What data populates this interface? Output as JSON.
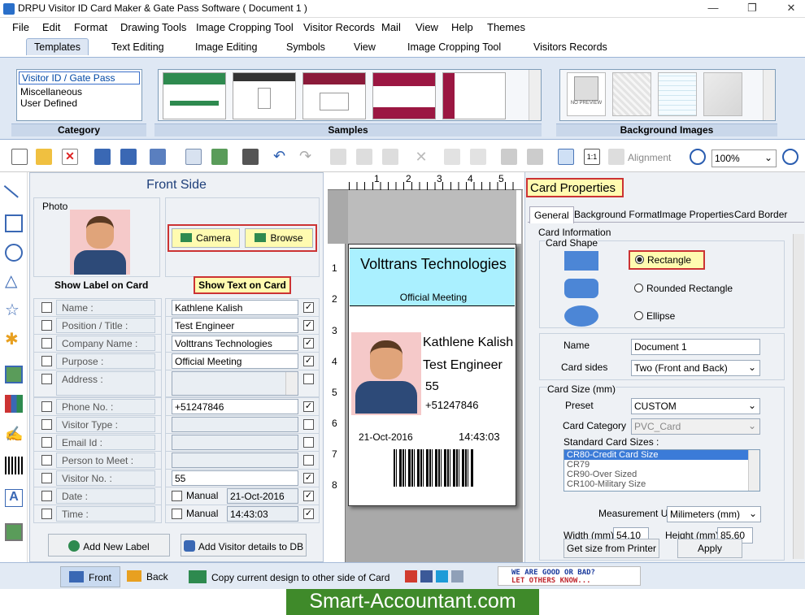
{
  "window": {
    "title": "DRPU Visitor ID Card Maker & Gate Pass Software ( Document 1 )",
    "min": "—",
    "max": "❐",
    "close": "✕"
  },
  "menu": [
    "File",
    "Edit",
    "Format",
    "Drawing Tools",
    "Image Cropping Tool",
    "Visitor Records",
    "Mail",
    "View",
    "Help",
    "Themes"
  ],
  "ribbon_tabs": [
    "Templates",
    "Text Editing",
    "Image Editing",
    "Symbols",
    "View",
    "Image Cropping Tool",
    "Visitors Records"
  ],
  "ribbon": {
    "category_items": [
      "Visitor ID / Gate Pass",
      "Miscellaneous",
      "User Defined"
    ],
    "category_label": "Category",
    "samples_label": "Samples",
    "bg_label": "Background Images",
    "no_preview": "NO PREVIEW"
  },
  "toolbar": {
    "alignment": "Alignment",
    "zoom": "100%"
  },
  "front": {
    "title": "Front Side",
    "photo_label": "Photo",
    "camera": "Camera",
    "browse": "Browse",
    "show_label": "Show Label on Card",
    "show_text": "Show Text on Card",
    "rows": [
      {
        "label": "Name :",
        "value": "Kathlene Kalish",
        "checked": true
      },
      {
        "label": "Position / Title :",
        "value": "Test Engineer",
        "checked": true
      },
      {
        "label": "Company Name :",
        "value": "Volttrans Technologies",
        "checked": true
      },
      {
        "label": "Purpose :",
        "value": "Official Meeting",
        "checked": true
      },
      {
        "label": "Address :",
        "value": "",
        "checked": false
      },
      {
        "label": "Phone No. :",
        "value": "+51247846",
        "checked": true
      },
      {
        "label": "Visitor Type :",
        "value": "",
        "checked": false
      },
      {
        "label": "Email Id :",
        "value": "",
        "checked": false
      },
      {
        "label": "Person to Meet :",
        "value": "",
        "checked": false
      },
      {
        "label": "Visitor No. :",
        "value": "55",
        "checked": true
      },
      {
        "label": "Date :",
        "value": "21-Oct-2016",
        "checked": true
      },
      {
        "label": "Time :",
        "value": "14:43:03",
        "checked": true
      }
    ],
    "manual": "Manual",
    "add_label": "Add New Label",
    "add_db": "Add Visitor details to DB"
  },
  "ruler": {
    "h": [
      "1",
      "2",
      "3",
      "4",
      "5"
    ],
    "v": [
      "1",
      "2",
      "3",
      "4",
      "5",
      "6",
      "7",
      "8"
    ]
  },
  "card": {
    "company": "Volttrans Technologies",
    "purpose": "Official Meeting",
    "name": "Kathlene Kalish",
    "title": "Test Engineer",
    "visitor_no": "55",
    "phone": "+51247846",
    "date": "21-Oct-2016",
    "time": "14:43:03",
    "header_color": "#aaf0ff"
  },
  "props": {
    "title": "Card Properties",
    "tabs": [
      "General",
      "Background Format",
      "Image Properties",
      "Card Border"
    ],
    "card_info": "Card Information",
    "card_shape": "Card Shape",
    "shapes": [
      "Rectangle",
      "Rounded Rectangle",
      "Ellipse"
    ],
    "name_label": "Name",
    "name_value": "Document 1",
    "sides_label": "Card sides",
    "sides_value": "Two (Front and Back)",
    "size_label": "Card Size (mm)",
    "preset_label": "Preset",
    "preset_value": "CUSTOM",
    "category_label": "Card Category",
    "category_value": "PVC_Card",
    "std_label": "Standard Card Sizes :",
    "std_sizes": [
      "CR80-Credit Card Size",
      "CR79",
      "CR90-Over Sized",
      "CR100-Military Size"
    ],
    "unit_label": "Measurement Unit :",
    "unit_value": "Milimeters (mm)",
    "width_label": "Width  (mm)",
    "width_value": "54.10",
    "height_label": "Height   (mm)",
    "height_value": "85.60",
    "get_size": "Get size from Printer",
    "apply": "Apply"
  },
  "status": {
    "front": "Front",
    "back": "Back",
    "copy": "Copy current design to other side of Card",
    "feedback1": "WE ARE GOOD OR BAD?",
    "feedback2": "LET OTHERS KNOW..."
  },
  "watermark": "Smart-Accountant.com"
}
